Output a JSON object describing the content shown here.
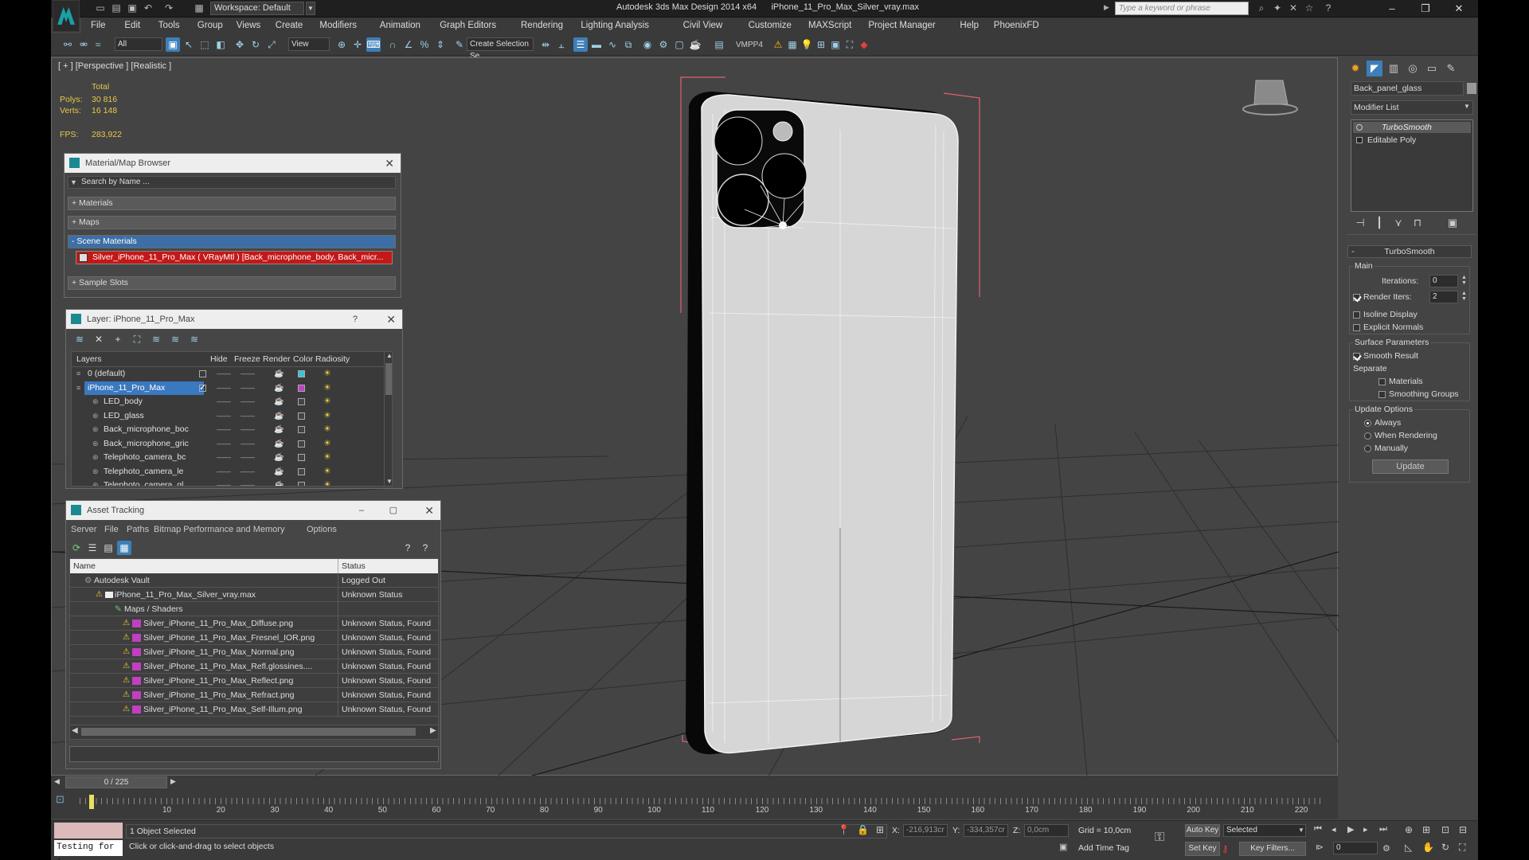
{
  "window": {
    "app_title": "Autodesk 3ds Max Design 2014 x64",
    "file_title": "iPhone_11_Pro_Max_Silver_vray.max",
    "workspace": "Workspace: Default",
    "search_placeholder": "Type a keyword or phrase"
  },
  "menu": [
    "File",
    "Edit",
    "Tools",
    "Group",
    "Views",
    "Create",
    "Modifiers",
    "Animation",
    "Graph Editors",
    "Rendering",
    "Lighting Analysis",
    "Civil View",
    "Customize",
    "MAXScript",
    "Project Manager",
    "Help",
    "PhoenixFD"
  ],
  "toolbar": {
    "filter_value": "All",
    "refcoord_value": "View",
    "selection_set_placeholder": "Create Selection Se",
    "vmpp": "VMPP4"
  },
  "viewport": {
    "label": "[ + ] [Perspective ] [Realistic ]",
    "stats": {
      "total": "Total",
      "polys_label": "Polys:",
      "polys_value": "30 816",
      "verts_label": "Verts:",
      "verts_value": "16 148",
      "fps_label": "FPS:",
      "fps_value": "283,922"
    }
  },
  "material_browser": {
    "title": "Material/Map Browser",
    "search_placeholder": "Search by Name ...",
    "sections": [
      "+ Materials",
      "+ Maps",
      "- Scene Materials",
      "+ Sample Slots"
    ],
    "scene_material": "Silver_iPhone_11_Pro_Max  ( VRayMtl )  [Back_microphone_body, Back_micr..."
  },
  "layer_panel": {
    "title": "Layer: iPhone_11_Pro_Max",
    "help": "?",
    "columns": [
      "Layers",
      "Hide",
      "Freeze",
      "Render",
      "Color",
      "Radiosity"
    ],
    "rows": [
      {
        "name": "0 (default)",
        "color": "#39c4d8"
      },
      {
        "name": "iPhone_11_Pro_Max",
        "color": "#c040c8"
      },
      {
        "name": "LED_body",
        "color": "#444444"
      },
      {
        "name": "LED_glass",
        "color": "#444444"
      },
      {
        "name": "Back_microphone_boc",
        "color": "#444444"
      },
      {
        "name": "Back_microphone_gric",
        "color": "#444444"
      },
      {
        "name": "Telephoto_camera_bc",
        "color": "#444444"
      },
      {
        "name": "Telephoto_camera_le",
        "color": "#444444"
      },
      {
        "name": "Telephoto_camera_gl",
        "color": "#444444"
      }
    ]
  },
  "asset_tracking": {
    "title": "Asset Tracking",
    "menu": [
      "Server",
      "File",
      "Paths",
      "Bitmap Performance and Memory",
      "Options"
    ],
    "columns": [
      "Name",
      "Status"
    ],
    "rows": [
      {
        "name": "Autodesk Vault",
        "status": "Logged Out"
      },
      {
        "name": "iPhone_11_Pro_Max_Silver_vray.max",
        "status": "Unknown Status"
      },
      {
        "name": "Maps / Shaders",
        "status": ""
      },
      {
        "name": "Silver_iPhone_11_Pro_Max_Diffuse.png",
        "status": "Unknown Status, Found"
      },
      {
        "name": "Silver_iPhone_11_Pro_Max_Fresnel_IOR.png",
        "status": "Unknown Status, Found"
      },
      {
        "name": "Silver_iPhone_11_Pro_Max_Normal.png",
        "status": "Unknown Status, Found"
      },
      {
        "name": "Silver_iPhone_11_Pro_Max_Refl.glossines....",
        "status": "Unknown Status, Found"
      },
      {
        "name": "Silver_iPhone_11_Pro_Max_Reflect.png",
        "status": "Unknown Status, Found"
      },
      {
        "name": "Silver_iPhone_11_Pro_Max_Refract.png",
        "status": "Unknown Status, Found"
      },
      {
        "name": "Silver_iPhone_11_Pro_Max_Self-Illum.png",
        "status": "Unknown Status, Found"
      }
    ]
  },
  "command_panel": {
    "object_name": "Back_panel_glass",
    "modifier_list": "Modifier List",
    "stack": [
      "TurboSmooth",
      "Editable Poly"
    ],
    "rollout_title": "TurboSmooth",
    "main_group": "Main",
    "iterations_label": "Iterations:",
    "iterations_value": "0",
    "render_iters_label": "Render Iters:",
    "render_iters_value": "2",
    "isoline": "Isoline Display",
    "explicit_normals": "Explicit Normals",
    "surface_params": "Surface Parameters",
    "smooth_result": "Smooth Result",
    "separate": "Separate",
    "materials": "Materials",
    "smoothing_groups": "Smoothing Groups",
    "update_options": "Update Options",
    "always": "Always",
    "when_rendering": "When Rendering",
    "manually": "Manually",
    "update_button": "Update"
  },
  "timeline": {
    "frame": "0 / 225",
    "ticks": [
      "10",
      "20",
      "30",
      "40",
      "50",
      "60",
      "70",
      "80",
      "90",
      "100",
      "110",
      "120",
      "130",
      "140",
      "150",
      "160",
      "170",
      "180",
      "190",
      "200",
      "210",
      "220"
    ]
  },
  "status": {
    "maxscript": "Testing for :",
    "selected": "1 Object Selected",
    "prompt": "Click or click-and-drag to select objects",
    "x_label": "X:",
    "x_value": "-216,913cr",
    "y_label": "Y:",
    "y_value": "-334,357cr",
    "z_label": "Z:",
    "z_value": "0,0cm",
    "grid": "Grid = 10,0cm",
    "add_time_tag": "Add Time Tag",
    "auto_key": "Auto Key",
    "set_key": "Set Key",
    "selected_combo": "Selected",
    "key_filters": "Key Filters...",
    "frame_value": "0"
  }
}
